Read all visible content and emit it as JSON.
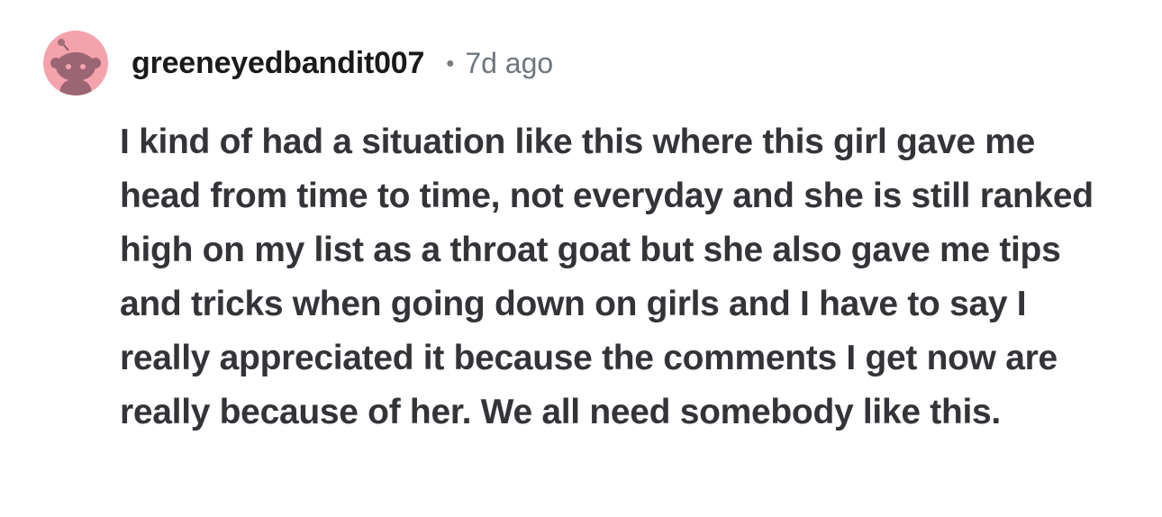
{
  "comment": {
    "author": "greeneyedbandit007",
    "separator": "•",
    "timestamp": "7d ago",
    "avatar_icon": "reddit-snoo-icon",
    "avatar_bg_color": "#f4a3ad",
    "body": "I kind of had a situation like this where this girl gave me head from time to time, not everyday and she is still ranked high on my list as a throat goat but she also gave me tips and tricks when going down on girls and I have to say I really appreciated it because the comments I get now are really because of her. We all need somebody like this."
  }
}
